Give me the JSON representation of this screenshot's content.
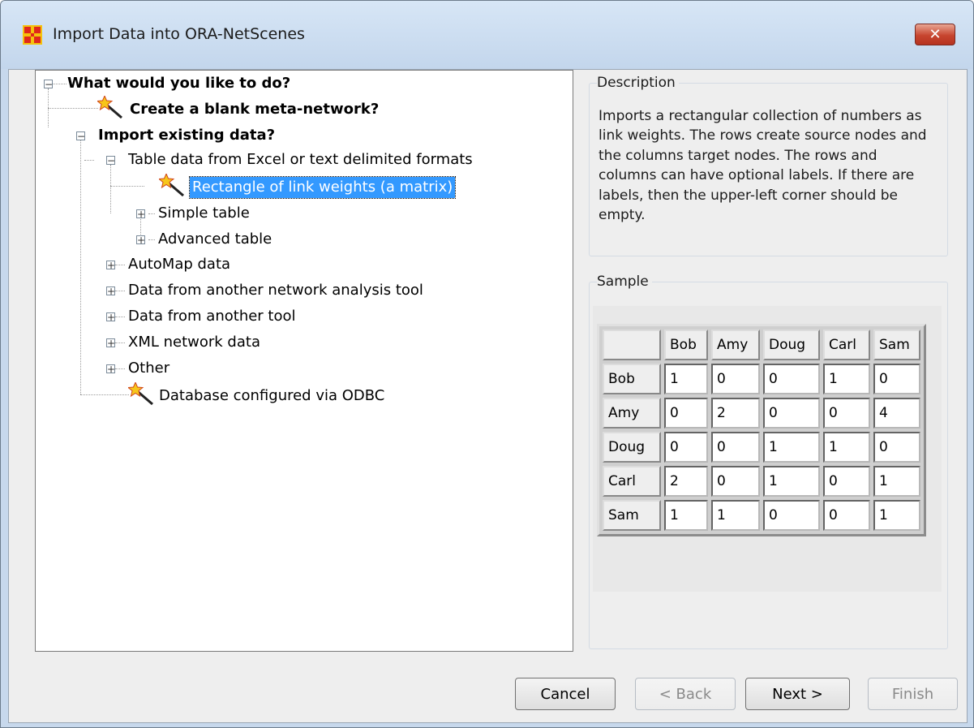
{
  "window": {
    "title": "Import Data into ORA-NetScenes",
    "close_label": "✕"
  },
  "tree": {
    "root": "What would you like to do?",
    "create_blank": "Create a blank meta-network?",
    "import_existing": "Import existing data?",
    "table_data": "Table data from Excel or text delimited formats",
    "rectangle": "Rectangle of link weights (a matrix)",
    "simple_table": "Simple table",
    "advanced_table": "Advanced table",
    "automap": "AutoMap data",
    "network_tool": "Data from another network analysis tool",
    "another_tool": "Data from another tool",
    "xml": "XML network data",
    "other": "Other",
    "database": "Database configured via ODBC"
  },
  "description": {
    "title": "Description",
    "text": "Imports a rectangular collection of numbers as link weights. The rows create source nodes and the columns target nodes. The rows and columns can have optional labels. If there are labels, then the upper-left corner should be empty."
  },
  "sample": {
    "title": "Sample",
    "headers": [
      "",
      "Bob",
      "Amy",
      "Doug",
      "Carl",
      "Sam"
    ],
    "rows": [
      [
        "Bob",
        "1",
        "0",
        "0",
        "1",
        "0"
      ],
      [
        "Amy",
        "0",
        "2",
        "0",
        "0",
        "4"
      ],
      [
        "Doug",
        "0",
        "0",
        "1",
        "1",
        "0"
      ],
      [
        "Carl",
        "2",
        "0",
        "1",
        "0",
        "1"
      ],
      [
        "Sam",
        "1",
        "1",
        "0",
        "0",
        "1"
      ]
    ]
  },
  "buttons": {
    "cancel": "Cancel",
    "back": "< Back",
    "next": "Next >",
    "finish": "Finish"
  }
}
